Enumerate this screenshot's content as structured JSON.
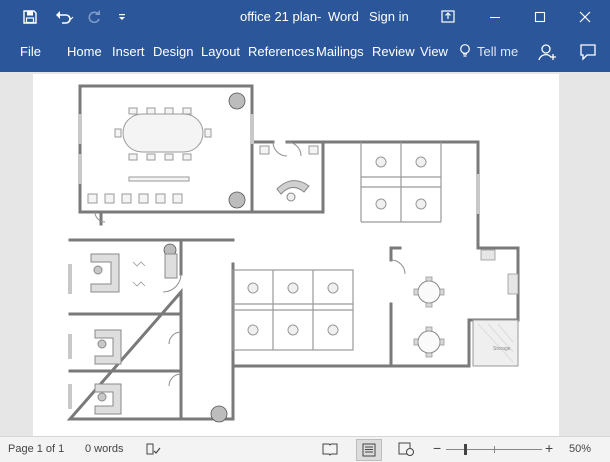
{
  "titlebar": {
    "document_title": "office 21 plan",
    "app_name": "Word",
    "separator": "-",
    "sign_in": "Sign in"
  },
  "ribbon": {
    "tabs": [
      "File",
      "Home",
      "Insert",
      "Design",
      "Layout",
      "References",
      "Mailings",
      "Review",
      "View"
    ],
    "tell_me": "Tell me"
  },
  "statusbar": {
    "page_info": "Page 1 of 1",
    "word_count": "0 words",
    "zoom_level": "50%",
    "zoom_out": "−",
    "zoom_in": "+"
  },
  "floorplan": {
    "utility_label": "Storage"
  },
  "colors": {
    "accent": "#2b579a",
    "wall": "#7a7a7a",
    "furniture": "#bdbdbd"
  },
  "icons": {
    "save": "save-icon",
    "undo": "undo-icon",
    "redo": "redo-icon",
    "customize": "customize-quick-access-icon",
    "ribbon_display": "ribbon-display-options-icon",
    "minimize": "minimize-icon",
    "restore": "restore-icon",
    "close": "close-icon",
    "tell_me": "lightbulb-icon",
    "share": "share-user-icon",
    "comments": "comments-icon",
    "proofing": "proofing-book-icon",
    "read_mode": "read-mode-icon",
    "print_layout": "print-layout-icon",
    "web_layout": "web-layout-icon"
  }
}
